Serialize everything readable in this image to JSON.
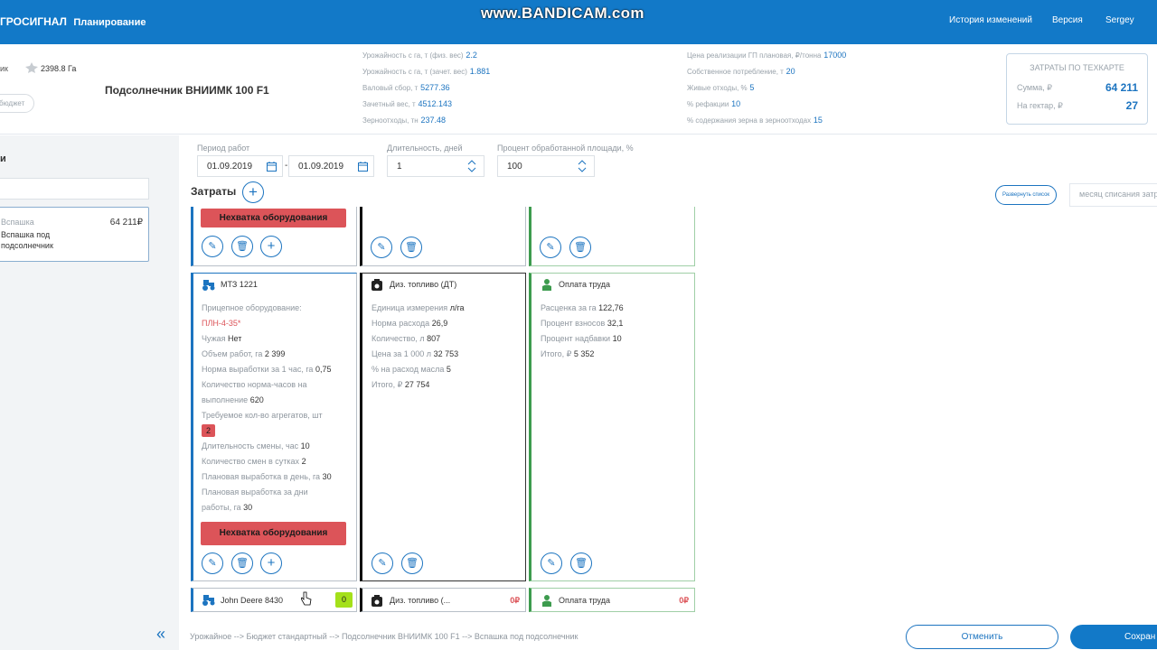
{
  "app": {
    "brand": "ГРОСИГНАЛ",
    "section": "Планирование",
    "watermark": "www.BANDICAM.com",
    "nav": [
      "История изменений",
      "Версия",
      "Sergey"
    ]
  },
  "info": {
    "field_label_left": "ик",
    "area": "2398.8 Га",
    "budget_pill": "бюджет",
    "crop_title": "Подсолнечник ВНИИМК 100 F1",
    "col1": [
      {
        "label": "Урожайность с га, т (физ. вес)",
        "value": "2.2"
      },
      {
        "label": "Урожайность с га, т (зачет. вес)",
        "value": "1.881"
      },
      {
        "label": "Валовый сбор, т",
        "value": "5277.36"
      },
      {
        "label": "Зачетный вес, т",
        "value": "4512.143"
      },
      {
        "label": "Зерноотходы, тн",
        "value": "237.48"
      }
    ],
    "col2": [
      {
        "label": "Цена реализации ГП плановая, ₽/тонна",
        "value": "17000"
      },
      {
        "label": "Собственное потребление, т",
        "value": "20"
      },
      {
        "label": "Живые отходы, %",
        "value": "5"
      },
      {
        "label": "% рефакции",
        "value": "10"
      },
      {
        "label": "% содержания зерна в зерноотходах",
        "value": "15"
      }
    ],
    "summary": {
      "title": "ЗАТРАТЫ ПО ТЕХКАРТЕ",
      "sum_label": "Сумма, ₽",
      "sum_value": "64 211",
      "per_ha_label": "На гектар, ₽",
      "per_ha_value": "27"
    }
  },
  "sidebar": {
    "heading": "и",
    "item": {
      "title": "Вспашка",
      "subtitle_1": "Вспашка под",
      "subtitle_2": "подсолнечник",
      "amount": "64 211₽"
    },
    "collapse_glyph": "«"
  },
  "form": {
    "period_label": "Период работ",
    "date_from": "01.09.2019",
    "date_sep": "-",
    "date_to": "01.09.2019",
    "duration_label": "Длительность, дней",
    "duration_value": "1",
    "percent_label": "Процент обработанной площади, %",
    "percent_value": "100",
    "costs_label": "Затраты",
    "add_glyph": "+",
    "expand_label": "Развернуть список",
    "month_placeholder": "месяц списания затр"
  },
  "cards": {
    "shortage_label": "Нехватка оборудования",
    "equipment": {
      "title": "МТЗ 1221",
      "trailer_label": "Прицепное оборудование:",
      "trailer_value": "ПЛН-4-35*",
      "rows": [
        {
          "label": "Чужая",
          "value": "Нет"
        },
        {
          "label": "Объем работ, га",
          "value": "2 399"
        },
        {
          "label": "Норма выработки за 1 час, га",
          "value": "0,75"
        },
        {
          "label": "Количество норма-часов на",
          "value": ""
        },
        {
          "label": "выполнение",
          "value": "620"
        },
        {
          "label": "Требуемое кол-во агрегатов, шт",
          "value": ""
        }
      ],
      "required_count": "2",
      "rows2": [
        {
          "label": "Длительность смены, час",
          "value": "10"
        },
        {
          "label": "Количество смен в сутках",
          "value": "2"
        },
        {
          "label": "Плановая выработка в день, га",
          "value": "30"
        },
        {
          "label": "Плановая выработка за дни",
          "value": ""
        },
        {
          "label": "работы, га",
          "value": "30"
        }
      ]
    },
    "fuel": {
      "title": "Диз. топливо (ДТ)",
      "rows": [
        {
          "label": "Единица измерения",
          "value": "л/га"
        },
        {
          "label": "Норма расхода",
          "value": "26,9"
        },
        {
          "label": "Количество, л",
          "value": "807"
        },
        {
          "label": "Цена за 1 000 л",
          "value": "32 753"
        },
        {
          "label": "% на расход масла",
          "value": "5"
        },
        {
          "label": "Итого, ₽",
          "value": "27 754"
        }
      ]
    },
    "labor": {
      "title": "Оплата труда",
      "rows": [
        {
          "label": "Расценка за га",
          "value": "122,76"
        },
        {
          "label": "Процент взносов",
          "value": "32,1"
        },
        {
          "label": "Процент надбавки",
          "value": "10"
        },
        {
          "label": "Итого, ₽",
          "value": "5 352"
        }
      ]
    },
    "bottom": {
      "equipment_title": "John Deere 8430",
      "equipment_badge": "0",
      "fuel_title": "Диз. топливо (...",
      "fuel_amount": "0₽",
      "labor_title": "Оплата труда",
      "labor_amount": "0₽"
    }
  },
  "footer": {
    "breadcrumb": "Урожайное --> Бюджет стандартный --> Подсолнечник ВНИИМК 100 F1 --> Вспашка под подсолнечник",
    "cancel_label": "Отменить",
    "save_label": "Сохран"
  },
  "colors": {
    "primary": "#1279c8",
    "danger": "#dc5459",
    "success": "#3d9b4e",
    "badge_green": "#a4e01a"
  }
}
